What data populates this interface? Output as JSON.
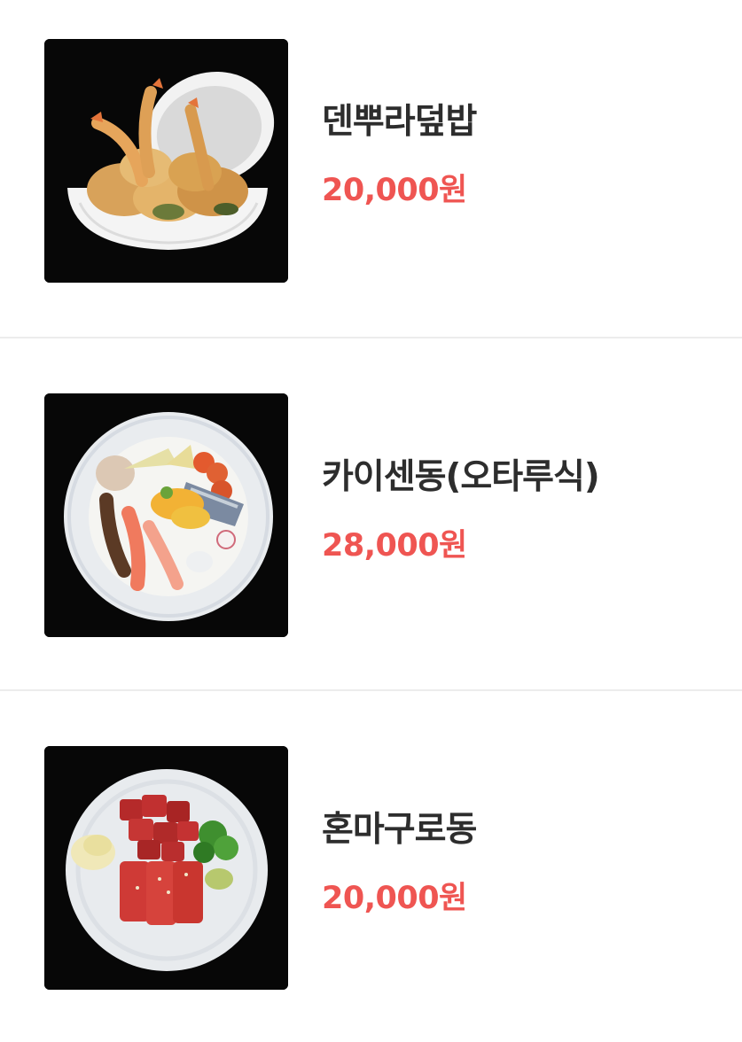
{
  "menu": {
    "items": [
      {
        "name": "덴뿌라덮밥",
        "price": "20,000원",
        "image_icon": "tempura-bowl-photo"
      },
      {
        "name": "카이센동(오타루식)",
        "price": "28,000원",
        "image_icon": "seafood-bowl-photo"
      },
      {
        "name": "혼마구로동",
        "price": "20,000원",
        "image_icon": "tuna-bowl-photo"
      }
    ]
  },
  "colors": {
    "price": "#ef5552",
    "name": "#2d2d2d",
    "divider": "#ececec",
    "image_background": "#070707"
  }
}
